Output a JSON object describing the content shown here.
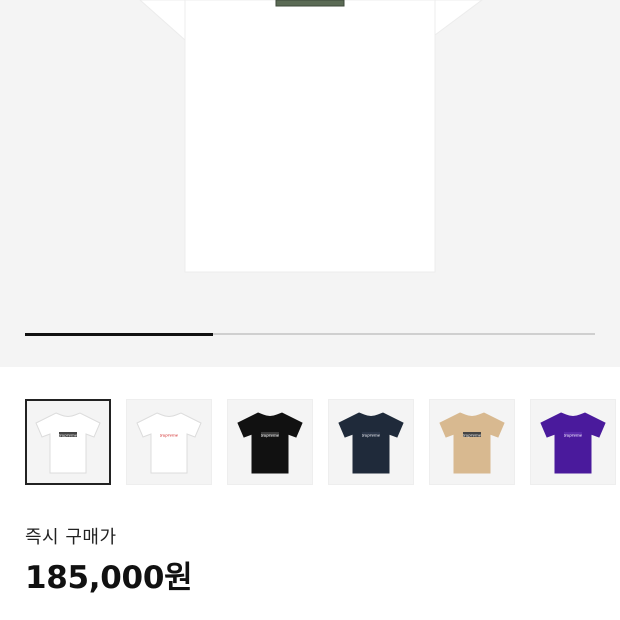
{
  "product": {
    "image_alt": "white t-shirt with photo box logo",
    "image_progress": 0.33
  },
  "variants": [
    {
      "color": "#ffffff",
      "logo": "#444444",
      "text": "Supreme",
      "selected": true
    },
    {
      "color": "#ffffff",
      "logo": "#ffffff",
      "text": "Supreme",
      "selected": false
    },
    {
      "color": "#111111",
      "logo": "#3a3a3a",
      "text": "Supreme",
      "selected": false
    },
    {
      "color": "#1f2a3a",
      "logo": "#2a3548",
      "text": "Supreme",
      "selected": false
    },
    {
      "color": "#d8b990",
      "logo": "#444444",
      "text": "Supreme",
      "selected": false
    },
    {
      "color": "#4a1a9c",
      "logo": "#5a2aac",
      "text": "Supreme",
      "selected": false
    }
  ],
  "price": {
    "label": "즉시 구매가",
    "value": "185,000원"
  }
}
